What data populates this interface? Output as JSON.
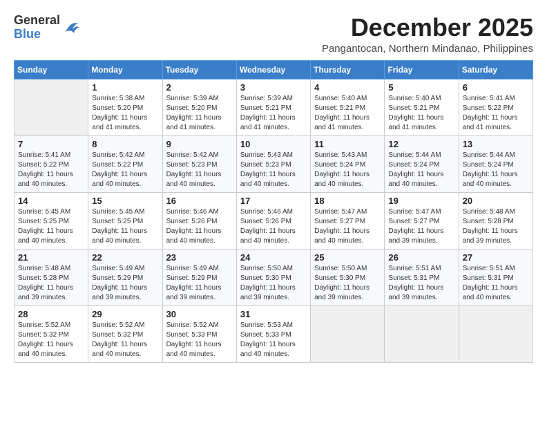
{
  "header": {
    "logo_general": "General",
    "logo_blue": "Blue",
    "month": "December 2025",
    "location": "Pangantocan, Northern Mindanao, Philippines"
  },
  "weekdays": [
    "Sunday",
    "Monday",
    "Tuesday",
    "Wednesday",
    "Thursday",
    "Friday",
    "Saturday"
  ],
  "weeks": [
    [
      {
        "day": "",
        "info": ""
      },
      {
        "day": "1",
        "info": "Sunrise: 5:38 AM\nSunset: 5:20 PM\nDaylight: 11 hours and 41 minutes."
      },
      {
        "day": "2",
        "info": "Sunrise: 5:39 AM\nSunset: 5:20 PM\nDaylight: 11 hours and 41 minutes."
      },
      {
        "day": "3",
        "info": "Sunrise: 5:39 AM\nSunset: 5:21 PM\nDaylight: 11 hours and 41 minutes."
      },
      {
        "day": "4",
        "info": "Sunrise: 5:40 AM\nSunset: 5:21 PM\nDaylight: 11 hours and 41 minutes."
      },
      {
        "day": "5",
        "info": "Sunrise: 5:40 AM\nSunset: 5:21 PM\nDaylight: 11 hours and 41 minutes."
      },
      {
        "day": "6",
        "info": "Sunrise: 5:41 AM\nSunset: 5:22 PM\nDaylight: 11 hours and 41 minutes."
      }
    ],
    [
      {
        "day": "7",
        "info": "Sunrise: 5:41 AM\nSunset: 5:22 PM\nDaylight: 11 hours and 40 minutes."
      },
      {
        "day": "8",
        "info": "Sunrise: 5:42 AM\nSunset: 5:22 PM\nDaylight: 11 hours and 40 minutes."
      },
      {
        "day": "9",
        "info": "Sunrise: 5:42 AM\nSunset: 5:23 PM\nDaylight: 11 hours and 40 minutes."
      },
      {
        "day": "10",
        "info": "Sunrise: 5:43 AM\nSunset: 5:23 PM\nDaylight: 11 hours and 40 minutes."
      },
      {
        "day": "11",
        "info": "Sunrise: 5:43 AM\nSunset: 5:24 PM\nDaylight: 11 hours and 40 minutes."
      },
      {
        "day": "12",
        "info": "Sunrise: 5:44 AM\nSunset: 5:24 PM\nDaylight: 11 hours and 40 minutes."
      },
      {
        "day": "13",
        "info": "Sunrise: 5:44 AM\nSunset: 5:24 PM\nDaylight: 11 hours and 40 minutes."
      }
    ],
    [
      {
        "day": "14",
        "info": "Sunrise: 5:45 AM\nSunset: 5:25 PM\nDaylight: 11 hours and 40 minutes."
      },
      {
        "day": "15",
        "info": "Sunrise: 5:45 AM\nSunset: 5:25 PM\nDaylight: 11 hours and 40 minutes."
      },
      {
        "day": "16",
        "info": "Sunrise: 5:46 AM\nSunset: 5:26 PM\nDaylight: 11 hours and 40 minutes."
      },
      {
        "day": "17",
        "info": "Sunrise: 5:46 AM\nSunset: 5:26 PM\nDaylight: 11 hours and 40 minutes."
      },
      {
        "day": "18",
        "info": "Sunrise: 5:47 AM\nSunset: 5:27 PM\nDaylight: 11 hours and 40 minutes."
      },
      {
        "day": "19",
        "info": "Sunrise: 5:47 AM\nSunset: 5:27 PM\nDaylight: 11 hours and 39 minutes."
      },
      {
        "day": "20",
        "info": "Sunrise: 5:48 AM\nSunset: 5:28 PM\nDaylight: 11 hours and 39 minutes."
      }
    ],
    [
      {
        "day": "21",
        "info": "Sunrise: 5:48 AM\nSunset: 5:28 PM\nDaylight: 11 hours and 39 minutes."
      },
      {
        "day": "22",
        "info": "Sunrise: 5:49 AM\nSunset: 5:29 PM\nDaylight: 11 hours and 39 minutes."
      },
      {
        "day": "23",
        "info": "Sunrise: 5:49 AM\nSunset: 5:29 PM\nDaylight: 11 hours and 39 minutes."
      },
      {
        "day": "24",
        "info": "Sunrise: 5:50 AM\nSunset: 5:30 PM\nDaylight: 11 hours and 39 minutes."
      },
      {
        "day": "25",
        "info": "Sunrise: 5:50 AM\nSunset: 5:30 PM\nDaylight: 11 hours and 39 minutes."
      },
      {
        "day": "26",
        "info": "Sunrise: 5:51 AM\nSunset: 5:31 PM\nDaylight: 11 hours and 39 minutes."
      },
      {
        "day": "27",
        "info": "Sunrise: 5:51 AM\nSunset: 5:31 PM\nDaylight: 11 hours and 40 minutes."
      }
    ],
    [
      {
        "day": "28",
        "info": "Sunrise: 5:52 AM\nSunset: 5:32 PM\nDaylight: 11 hours and 40 minutes."
      },
      {
        "day": "29",
        "info": "Sunrise: 5:52 AM\nSunset: 5:32 PM\nDaylight: 11 hours and 40 minutes."
      },
      {
        "day": "30",
        "info": "Sunrise: 5:52 AM\nSunset: 5:33 PM\nDaylight: 11 hours and 40 minutes."
      },
      {
        "day": "31",
        "info": "Sunrise: 5:53 AM\nSunset: 5:33 PM\nDaylight: 11 hours and 40 minutes."
      },
      {
        "day": "",
        "info": ""
      },
      {
        "day": "",
        "info": ""
      },
      {
        "day": "",
        "info": ""
      }
    ]
  ]
}
